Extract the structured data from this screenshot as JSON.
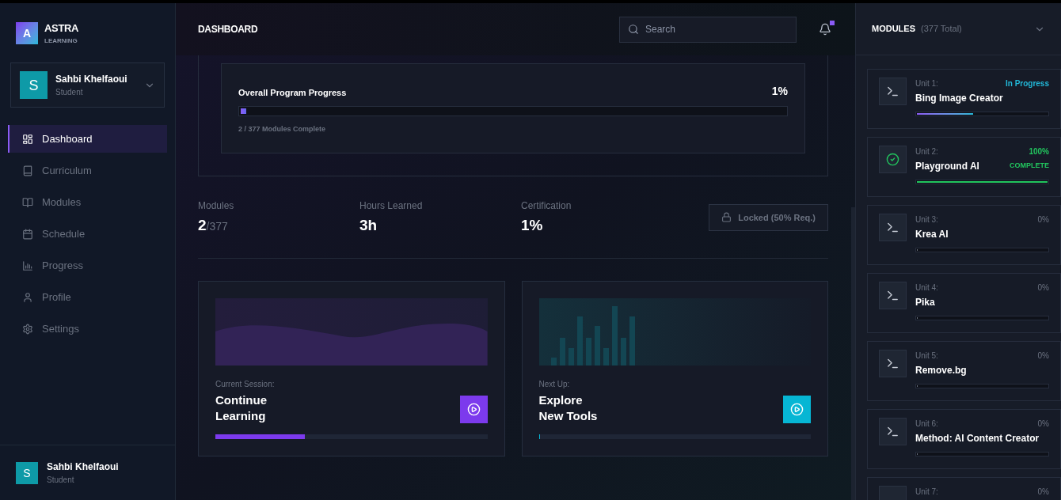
{
  "brand": {
    "logo_letter": "A",
    "name": "ASTRA",
    "tagline": "LEARNING"
  },
  "user_card": {
    "initial": "S",
    "name": "Sahbi Khelfaoui",
    "role": "Student"
  },
  "nav": [
    {
      "label": "Dashboard",
      "selected": true
    },
    {
      "label": "Curriculum",
      "selected": false
    },
    {
      "label": "Modules",
      "selected": false
    },
    {
      "label": "Schedule",
      "selected": false
    },
    {
      "label": "Progress",
      "selected": false
    },
    {
      "label": "Profile",
      "selected": false
    },
    {
      "label": "Settings",
      "selected": false
    }
  ],
  "footer_user": {
    "initial": "S",
    "name": "Sahbi Khelfaoui",
    "role": "Student"
  },
  "header": {
    "title": "DASHBOARD",
    "search": {
      "placeholder": "Search"
    },
    "notification_unread": true
  },
  "overall_progress": {
    "title": "Overall Program Progress",
    "percent": "1%",
    "level": 0.01,
    "caption": "2 / 377 Modules Complete"
  },
  "stats": [
    {
      "label": "Modules",
      "value": "2",
      "suffix": "/377"
    },
    {
      "label": "Hours Learned",
      "value": "3h"
    },
    {
      "label": "Certification",
      "value": "1%"
    }
  ],
  "certificate_button": {
    "label": "Locked (50% Req.)",
    "disabled": true
  },
  "cards": [
    {
      "kind": "wave",
      "label": "Current Session:",
      "title_lines": [
        "Continue",
        "Learning"
      ],
      "level": 0.33,
      "color": "#7c3aed"
    },
    {
      "kind": "bars",
      "label": "Next Up:",
      "title_lines": [
        "Explore",
        "New Tools"
      ],
      "level": 0,
      "color": "#06b6d4"
    }
  ],
  "modules_panel": {
    "title": "MODULES",
    "count": "(377 Total)",
    "expanded": true,
    "items": [
      {
        "kind": "in_progress",
        "unit": "Unit 1:",
        "name": "Bing Image Creator",
        "status": "In Progress",
        "level": 0.43
      },
      {
        "kind": "complete",
        "unit": "Unit 2:",
        "name": "Playground AI",
        "status": "100%",
        "badge": "COMPLETE",
        "level": 1
      },
      {
        "kind": "not_started",
        "unit": "Unit 3:",
        "name": "Krea AI",
        "status": "0%",
        "level": 0
      },
      {
        "kind": "not_started",
        "unit": "Unit 4:",
        "name": "Pika",
        "status": "0%",
        "level": 0
      },
      {
        "kind": "not_started",
        "unit": "Unit 5:",
        "name": "Remove.bg",
        "status": "0%",
        "level": 0
      },
      {
        "kind": "not_started",
        "unit": "Unit 6:",
        "name": "Method: AI Content Creator",
        "status": "0%",
        "level": 0
      },
      {
        "kind": "not_started",
        "unit": "Unit 7:",
        "status": "0%"
      }
    ]
  }
}
